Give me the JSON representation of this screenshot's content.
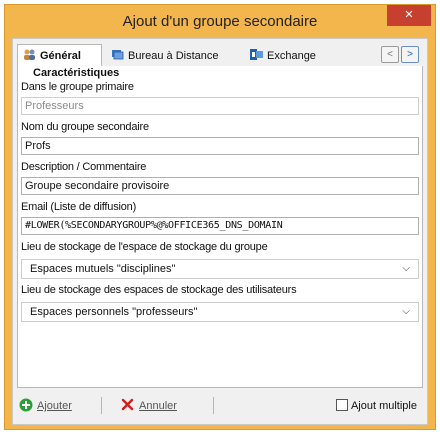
{
  "window": {
    "title": "Ajout d'un groupe secondaire",
    "close_glyph": "×"
  },
  "tabs": [
    {
      "label": "Général",
      "icon": "group-icon",
      "active": true
    },
    {
      "label": "Bureau à Distance",
      "icon": "remote-desktop-icon",
      "active": false
    },
    {
      "label": "Exchange",
      "icon": "exchange-icon",
      "active": false
    }
  ],
  "tab_nav": {
    "prev": "<",
    "next": ">"
  },
  "form": {
    "section": "Caractéristiques",
    "primary_group": {
      "label": "Dans le groupe primaire",
      "value": "Professeurs"
    },
    "secondary_name": {
      "label": "Nom du groupe secondaire",
      "value": "Profs"
    },
    "description": {
      "label": "Description / Commentaire",
      "value": "Groupe secondaire provisoire"
    },
    "email": {
      "label": "Email (Liste de diffusion)",
      "value": "#LOWER(%SECONDARYGROUP%@%OFFICE365_DNS_DOMAIN"
    },
    "group_storage": {
      "label": "Lieu de stockage de l'espace de stockage du groupe",
      "value": "Espaces mutuels \"disciplines\""
    },
    "users_storage": {
      "label": "Lieu de stockage des espaces de stockage des utilisateurs",
      "value": "Espaces personnels \"professeurs\""
    }
  },
  "footer": {
    "add": "Ajouter",
    "cancel": "Annuler",
    "multi": "Ajout multiple"
  },
  "colors": {
    "titlebar": "#f3b64d",
    "close": "#c7402f",
    "add_icon": "#2e9e3a",
    "cancel_icon": "#d11f1f"
  }
}
